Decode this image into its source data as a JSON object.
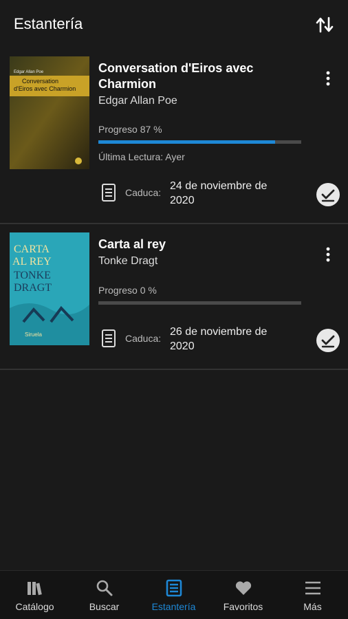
{
  "header": {
    "title": "Estantería"
  },
  "books": [
    {
      "title": "Conversation d'Eiros avec Charmion",
      "author": "Edgar Allan Poe",
      "progress_label": "Progreso 87 %",
      "progress": 0.87,
      "last_read": "Última Lectura: Ayer",
      "expires_label": "Caduca:",
      "expires_date": "24 de noviembre de 2020",
      "cover": {
        "small_author": "Edgar Allan Poe",
        "line1": "Conversation",
        "line2": "d'Eiros avec Charmion"
      }
    },
    {
      "title": "Carta al rey",
      "author": "Tonke Dragt",
      "progress_label": "Progreso 0 %",
      "progress": 0.0,
      "expires_label": "Caduca:",
      "expires_date": "26 de noviembre de 2020",
      "cover": {
        "line1": "CARTA",
        "line2": "AL REY",
        "line3": "TONKE",
        "line4": "DRAGT",
        "publisher": "Siruela"
      }
    }
  ],
  "nav": [
    {
      "label": "Catálogo",
      "icon": "library-icon"
    },
    {
      "label": "Buscar",
      "icon": "search-icon"
    },
    {
      "label": "Estantería",
      "icon": "bookshelf-icon",
      "active": true
    },
    {
      "label": "Favoritos",
      "icon": "heart-icon"
    },
    {
      "label": "Más",
      "icon": "menu-icon"
    }
  ],
  "colors": {
    "accent": "#1e88d6",
    "background": "#1a1a1a"
  }
}
